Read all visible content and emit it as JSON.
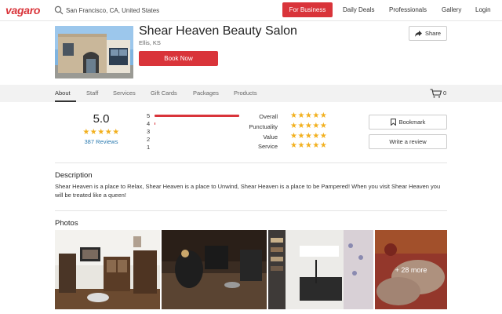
{
  "topnav": {
    "logo": "vagaro",
    "search_value": "San Francisco, CA, United States",
    "business_button": "For Business",
    "links": [
      "Daily Deals",
      "Professionals",
      "Gallery",
      "Login"
    ]
  },
  "salon": {
    "name": "Shear Heaven Beauty Salon",
    "location": "Ellis, KS",
    "book_button": "Book Now",
    "share_button": "Share"
  },
  "tabs": [
    "About",
    "Staff",
    "Services",
    "Gift Cards",
    "Packages",
    "Products"
  ],
  "active_tab": "About",
  "cart_count": "0",
  "rating": {
    "score": "5.0",
    "stars": "★★★★★",
    "reviews": "387 Reviews",
    "distribution": [
      {
        "label": "5",
        "fraction": 0.99
      },
      {
        "label": "4",
        "fraction": 0.01
      },
      {
        "label": "3",
        "fraction": 0
      },
      {
        "label": "2",
        "fraction": 0
      },
      {
        "label": "1",
        "fraction": 0
      }
    ],
    "categories": [
      {
        "label": "Overall",
        "stars": "★★★★★"
      },
      {
        "label": "Punctuality",
        "stars": "★★★★★"
      },
      {
        "label": "Value",
        "stars": "★★★★★"
      },
      {
        "label": "Service",
        "stars": "★★★★★"
      }
    ],
    "bookmark_button": "Bookmark",
    "review_button": "Write a review"
  },
  "description": {
    "title": "Description",
    "text": "Shear Heaven is a place to Relax, Shear Heaven is a place to Unwind, Shear Heaven is a place to be Pampered! When you visit Shear Heaven you will be treated like a queen!"
  },
  "photos": {
    "title": "Photos",
    "more_label": "+ 28 more"
  },
  "colors": {
    "brand": "#d9343a",
    "star": "#f2b01e",
    "link": "#2a7ab0"
  }
}
